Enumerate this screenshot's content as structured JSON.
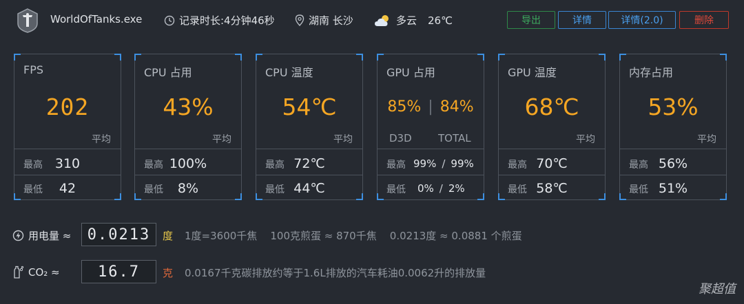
{
  "header": {
    "app_name": "WorldOfTanks.exe",
    "record_duration": "记录时长:4分钟46秒",
    "location": "湖南 长沙",
    "weather": "多云",
    "temperature": "26℃",
    "buttons": {
      "export": "导出",
      "detail": "详情",
      "detail_v2": "详情(2.0)",
      "delete": "删除"
    }
  },
  "cards": {
    "fps": {
      "title": "FPS",
      "value": "202",
      "avg_label": "平均",
      "max_label": "最高",
      "max": "310",
      "min_label": "最低",
      "min": "42"
    },
    "cpu_usage": {
      "title": "CPU 占用",
      "value": "43%",
      "avg_label": "平均",
      "max_label": "最高",
      "max": "100%",
      "min_label": "最低",
      "min": "8%"
    },
    "cpu_temp": {
      "title": "CPU 温度",
      "value": "54℃",
      "avg_label": "平均",
      "max_label": "最高",
      "max": "72℃",
      "min_label": "最低",
      "min": "44℃"
    },
    "gpu_usage": {
      "title": "GPU 占用",
      "d3d_value": "85%",
      "total_value": "84%",
      "d3d_label": "D3D",
      "total_label": "TOTAL",
      "max_label": "最高",
      "max_d3d": "99%",
      "max_total": "99%",
      "min_label": "最低",
      "min_d3d": "0%",
      "min_total": "2%",
      "slash": "/"
    },
    "gpu_temp": {
      "title": "GPU 温度",
      "value": "68℃",
      "avg_label": "平均",
      "max_label": "最高",
      "max": "70℃",
      "min_label": "最低",
      "min": "58℃"
    },
    "mem_usage": {
      "title": "内存占用",
      "value": "53%",
      "avg_label": "平均",
      "max_label": "最高",
      "max": "56%",
      "min_label": "最低",
      "min": "51%"
    }
  },
  "power": {
    "label": "用电量 ≈",
    "display": "0.0213",
    "unit": "度",
    "unit_color": "#e8c84a",
    "note": "1度=3600千焦    100克煎蛋 ≈ 870千焦    0.0213度 ≈ 0.0881 个煎蛋"
  },
  "co2": {
    "label": "CO₂ ≈",
    "display": "16.7",
    "unit": "克",
    "unit_color": "#e0683a",
    "note": "0.0167千克碳排放约等于1.6L排放的汽车耗油0.0062升的排放量"
  },
  "watermark": "聚超值",
  "colors": {
    "accent_value": "#f5a623",
    "corner": "#3d8fe0",
    "export": "#3daa5e",
    "detail": "#4aa0f0",
    "delete": "#e0493a"
  },
  "icons": {
    "app": "tank-logo-icon",
    "clock": "clock-icon",
    "location": "location-pin-icon",
    "weather": "partly-cloudy-icon",
    "power": "power-icon",
    "co2": "co2-icon"
  }
}
